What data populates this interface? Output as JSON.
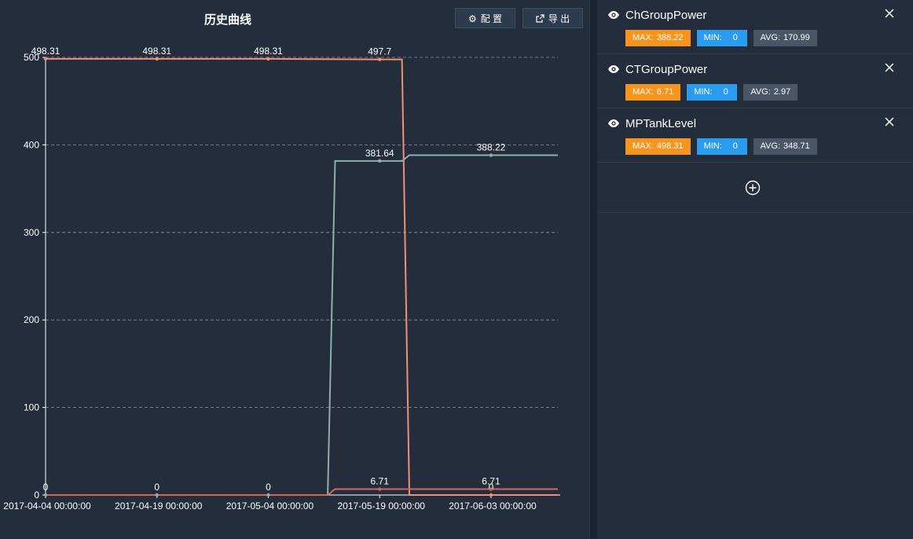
{
  "toolbar": {
    "title": "历史曲线",
    "config_label": "配 置",
    "export_label": "导 出"
  },
  "chart_data": {
    "type": "line",
    "title": "历史曲线",
    "x_tick_labels": [
      "2017-04-04 00:00:00",
      "2017-04-19 00:00:00",
      "2017-05-04 00:00:00",
      "2017-05-19 00:00:00",
      "2017-06-03 00:00:00"
    ],
    "y_ticks": [
      0,
      100,
      200,
      300,
      400,
      500
    ],
    "ylim": [
      0,
      500
    ],
    "x_range": [
      "2017-04-04",
      "2017-06-12"
    ],
    "grid": "horizontal dashed",
    "series": [
      {
        "name": "MPTankLevel",
        "color": "#f09077",
        "points": [
          {
            "x": "2017-04-04",
            "y": 498.31
          },
          {
            "x": "2017-04-19",
            "y": 498.31
          },
          {
            "x": "2017-05-04",
            "y": 498.31
          },
          {
            "x": "2017-05-19",
            "y": 497.7
          },
          {
            "x": "2017-05-22",
            "y": 497.7
          },
          {
            "x": "2017-05-23",
            "y": 0
          },
          {
            "x": "2017-06-12",
            "y": 0
          }
        ],
        "labels": [
          {
            "x": "2017-04-04",
            "y": 498.31,
            "text": "498.31"
          },
          {
            "x": "2017-04-19",
            "y": 498.31,
            "text": "498.31"
          },
          {
            "x": "2017-05-04",
            "y": 498.31,
            "text": "498.31"
          },
          {
            "x": "2017-05-19",
            "y": 497.7,
            "text": "497.7"
          },
          {
            "x": "2017-06-03",
            "y": 0,
            "text": "0"
          }
        ]
      },
      {
        "name": "ChGroupPower",
        "color": "#8fb1aa",
        "points": [
          {
            "x": "2017-04-04",
            "y": 0
          },
          {
            "x": "2017-05-12",
            "y": 0
          },
          {
            "x": "2017-05-13",
            "y": 381.64
          },
          {
            "x": "2017-05-19",
            "y": 381.64
          },
          {
            "x": "2017-05-22",
            "y": 381.64
          },
          {
            "x": "2017-05-23",
            "y": 388.22
          },
          {
            "x": "2017-06-12",
            "y": 388.22
          }
        ],
        "labels": [
          {
            "x": "2017-04-04",
            "y": 0,
            "text": "0"
          },
          {
            "x": "2017-04-19",
            "y": 0,
            "text": "0"
          },
          {
            "x": "2017-05-04",
            "y": 0,
            "text": "0"
          },
          {
            "x": "2017-05-19",
            "y": 381.64,
            "text": "381.64"
          },
          {
            "x": "2017-06-03",
            "y": 388.22,
            "text": "388.22"
          }
        ]
      },
      {
        "name": "CTGroupPower",
        "color": "#d8655a",
        "points": [
          {
            "x": "2017-04-04",
            "y": 0
          },
          {
            "x": "2017-05-12",
            "y": 0
          },
          {
            "x": "2017-05-13",
            "y": 6.71
          },
          {
            "x": "2017-06-12",
            "y": 6.71
          }
        ],
        "labels": [
          {
            "x": "2017-05-19",
            "y": 6.71,
            "text": "6.71"
          },
          {
            "x": "2017-06-03",
            "y": 6.71,
            "text": "6.71"
          }
        ]
      }
    ]
  },
  "series_panel": {
    "items": [
      {
        "name": "ChGroupPower",
        "max_label": "MAX:",
        "max": "388.22",
        "min_label": "MIN:",
        "min": "0",
        "avg_label": "AVG:",
        "avg": "170.99"
      },
      {
        "name": "CTGroupPower",
        "max_label": "MAX:",
        "max": "6.71",
        "min_label": "MIN:",
        "min": "0",
        "avg_label": "AVG:",
        "avg": "2.97"
      },
      {
        "name": "MPTankLevel",
        "max_label": "MAX:",
        "max": "498.31",
        "min_label": "MIN:",
        "min": "0",
        "avg_label": "AVG:",
        "avg": "348.71"
      }
    ]
  }
}
